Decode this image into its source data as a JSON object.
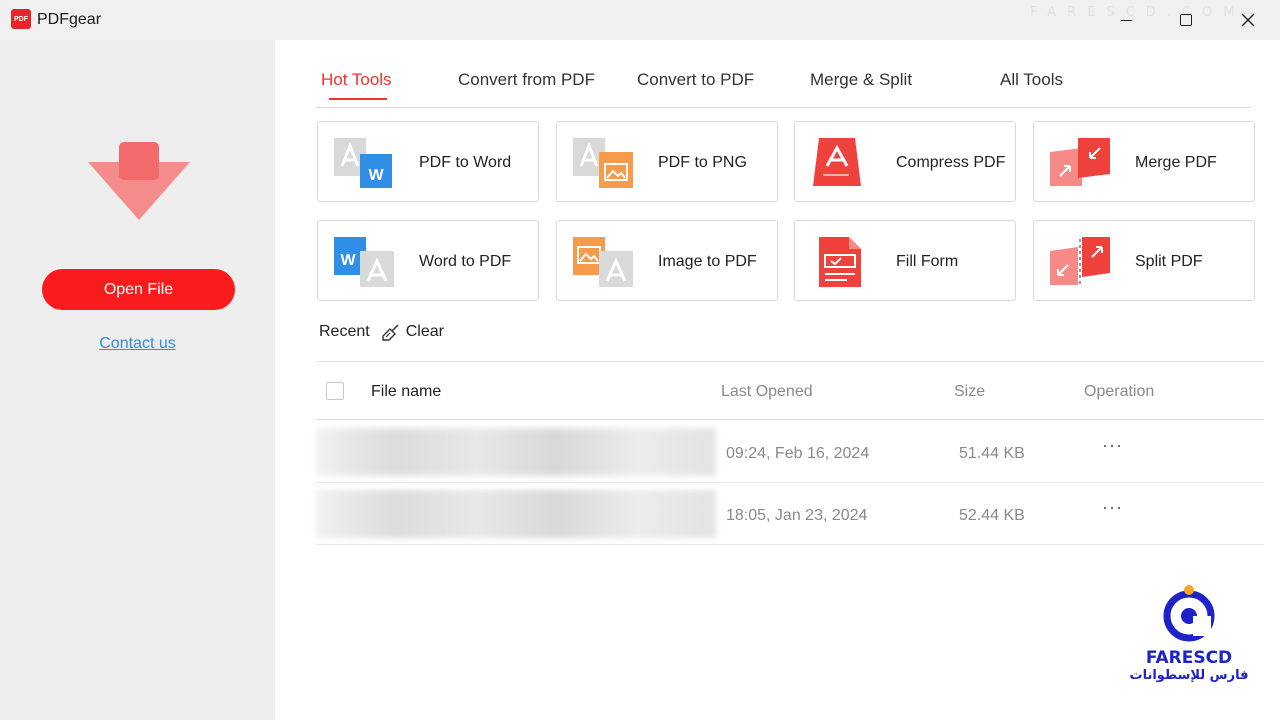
{
  "window": {
    "title": "PDFgear",
    "logo_text": "PDF",
    "watermark": "FARESCD.COM"
  },
  "sidebar": {
    "open_file_label": "Open File",
    "contact_label": "Contact us"
  },
  "tabs": [
    {
      "label": "Hot Tools",
      "active": true
    },
    {
      "label": "Convert from PDF",
      "active": false
    },
    {
      "label": "Convert to PDF",
      "active": false
    },
    {
      "label": "Merge & Split",
      "active": false
    },
    {
      "label": "All Tools",
      "active": false
    }
  ],
  "tools": [
    {
      "label": "PDF to Word",
      "icon": "pdf-to-word-icon"
    },
    {
      "label": "PDF to PNG",
      "icon": "pdf-to-png-icon"
    },
    {
      "label": "Compress PDF",
      "icon": "compress-pdf-icon"
    },
    {
      "label": "Merge PDF",
      "icon": "merge-pdf-icon"
    },
    {
      "label": "Word to PDF",
      "icon": "word-to-pdf-icon"
    },
    {
      "label": "Image to PDF",
      "icon": "image-to-pdf-icon"
    },
    {
      "label": "Fill Form",
      "icon": "fill-form-icon"
    },
    {
      "label": "Split PDF",
      "icon": "split-pdf-icon"
    }
  ],
  "recent": {
    "label": "Recent",
    "clear_label": "Clear",
    "columns": {
      "file_name": "File name",
      "last_opened": "Last Opened",
      "size": "Size",
      "operation": "Operation"
    },
    "rows": [
      {
        "last_opened": "09:24, Feb 16, 2024",
        "size": "51.44 KB",
        "operation": "···"
      },
      {
        "last_opened": "18:05, Jan 23, 2024",
        "size": "52.44 KB",
        "operation": "···"
      }
    ]
  },
  "watermark": {
    "brand": "FARESCD",
    "arabic": "فارس للإسطوانات"
  },
  "colors": {
    "accent": "#f0302c",
    "button": "#fa1c1c",
    "link": "#2f8ee6",
    "sidebar_bg": "#eeeeef",
    "watermark": "#1e22c8"
  }
}
